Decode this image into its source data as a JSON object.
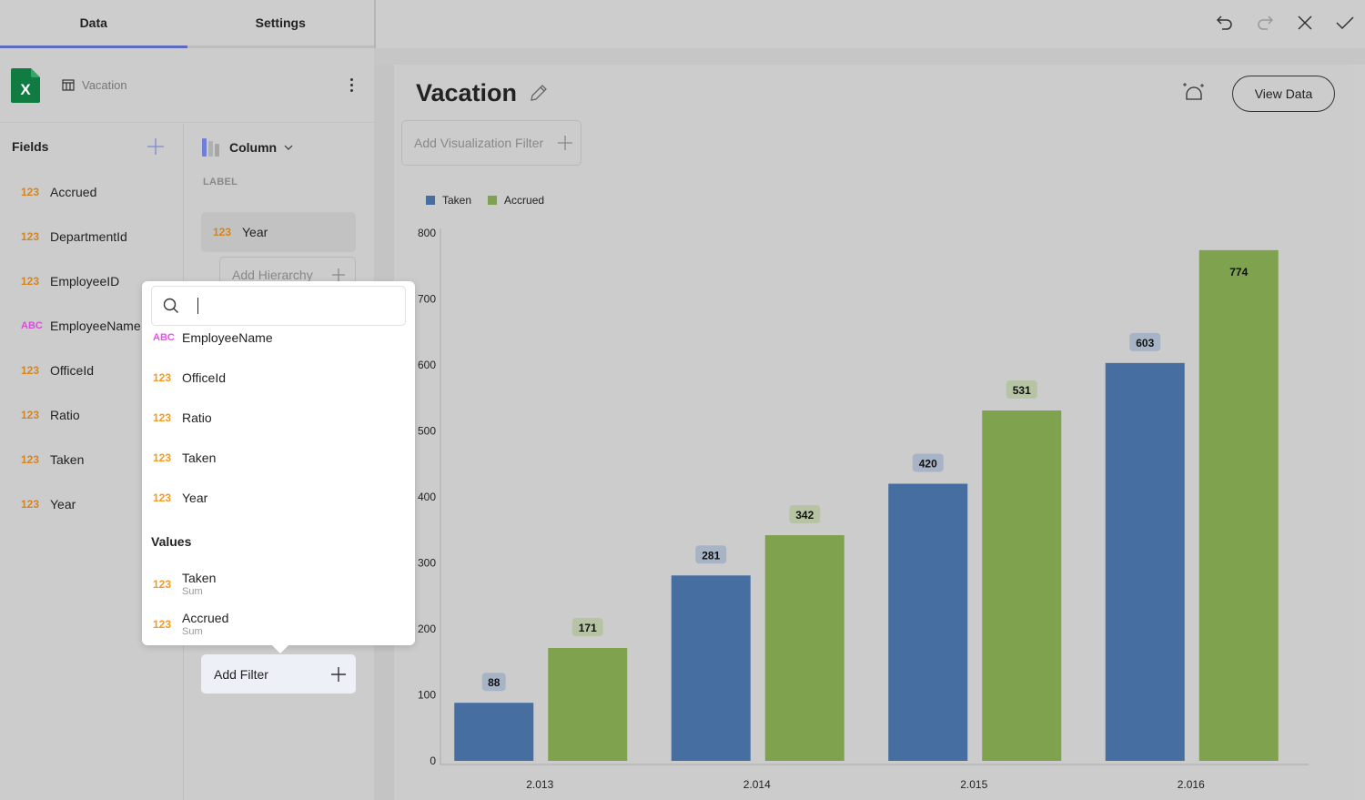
{
  "tabs": [
    {
      "label": "Data",
      "active": true
    },
    {
      "label": "Settings",
      "active": false
    }
  ],
  "topbar": {
    "icons": [
      "undo-icon",
      "redo-icon",
      "close-icon",
      "check-icon"
    ]
  },
  "datasource": {
    "icon": "excel-icon",
    "name": "Vacation"
  },
  "fields": {
    "header": "Fields",
    "items": [
      {
        "type": "123",
        "kind": "num",
        "name": "Accrued"
      },
      {
        "type": "123",
        "kind": "num",
        "name": "DepartmentId"
      },
      {
        "type": "123",
        "kind": "num",
        "name": "EmployeeID"
      },
      {
        "type": "ABC",
        "kind": "txt",
        "name": "EmployeeName"
      },
      {
        "type": "123",
        "kind": "num",
        "name": "OfficeId"
      },
      {
        "type": "123",
        "kind": "num",
        "name": "Ratio"
      },
      {
        "type": "123",
        "kind": "num",
        "name": "Taken"
      },
      {
        "type": "123",
        "kind": "num",
        "name": "Year"
      }
    ]
  },
  "config": {
    "viz_type": "Column",
    "label_section": "LABEL",
    "label_chip": {
      "type": "123",
      "name": "Year"
    },
    "add_hierarchy": "Add Hierarchy",
    "add_filter": "Add Filter"
  },
  "popup": {
    "search_value": "",
    "items": [
      {
        "type": "ABC",
        "kind": "txt",
        "name": "EmployeeName"
      },
      {
        "type": "123",
        "kind": "num",
        "name": "OfficeId"
      },
      {
        "type": "123",
        "kind": "num",
        "name": "Ratio"
      },
      {
        "type": "123",
        "kind": "num",
        "name": "Taken"
      },
      {
        "type": "123",
        "kind": "num",
        "name": "Year"
      }
    ],
    "values_header": "Values",
    "values": [
      {
        "type": "123",
        "name": "Taken",
        "agg": "Sum"
      },
      {
        "type": "123",
        "name": "Accrued",
        "agg": "Sum"
      }
    ]
  },
  "main": {
    "title": "Vacation",
    "viz_filter": "Add Visualization Filter",
    "view_data": "View Data"
  },
  "colors": {
    "accent": "#5c6bc0",
    "taken": "#476ea1",
    "accrued": "#7ea24e"
  },
  "chart_data": {
    "type": "bar",
    "title": "",
    "xlabel": "",
    "ylabel": "",
    "categories": [
      "2.013",
      "2.014",
      "2.015",
      "2.016"
    ],
    "series": [
      {
        "name": "Taken",
        "values": [
          88,
          281,
          420,
          603
        ]
      },
      {
        "name": "Accrued",
        "values": [
          171,
          342,
          531,
          774
        ]
      }
    ],
    "ylim": [
      0,
      800
    ],
    "yticks": [
      0,
      100,
      200,
      300,
      400,
      500,
      600,
      700,
      800
    ],
    "grid": false,
    "legend": "top-left",
    "data_labels": true
  }
}
